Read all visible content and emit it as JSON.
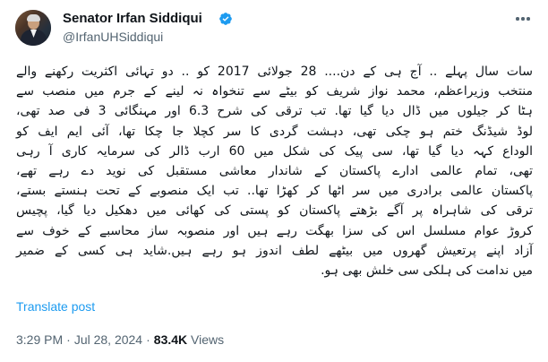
{
  "author": {
    "name": "Senator Irfan Siddiqui",
    "handle": "@IrfanUHSiddiqui",
    "avatar_icon": "avatar-photo",
    "verified_icon": "verified-badge-icon",
    "verified_color": "#1d9bf0"
  },
  "post": {
    "lines": [
      "سات سال پہلے .. آج ہی کے دن.... 28 جولائی 2017 کو .. دو تہائی اکثریت رکھنے والے",
      "منتخب وزیراعظم، محمد نواز شریف کو بیٹے سے تنخواہ نہ لینے کے جرم میں منصب سے",
      "ہٹا کر جیلوں میں ڈال دیا گیا تھا. تب ترقی کی شرح 6.3 اور مہنگائی 3 فی صد تھی،",
      "لوڈ شیڈنگ ختم ہو چکی تھی، دہشت گردی کا سر کچلا جا چکا تھا، آئی ایم ایف کو",
      "الوداع کہہ دیا گیا تھا، سی پیک کی شکل میں 60 ارب ڈالر کی سرمایہ کاری آ رہی",
      "تھی، تمام عالمی ادارے پاکستان کے شاندار معاشی مستقبل کی نوید دے رہے تھے،",
      "پاکستان عالمی برادری میں سر اٹھا کر کھڑا تھا.. تب ایک منصوبے کے تحت ہنستے بستے،",
      "ترقی کی شاہراہ پر آگے بڑھتے پاکستان کو پستی کی کھائی میں دھکیل دیا گیا، پچیس",
      "کروڑ عوام مسلسل اس کی سزا بھگت رہے ہیں اور منصوبہ ساز محاسبے کے خوف سے",
      "آزاد اپنے پرتعیش گھروں میں بیٹھے لطف اندوز ہو رہے ہیں.شاید ہی کسی کے ضمیر",
      "میں ندامت کی ہلکی سی خلش بھی ہو."
    ],
    "translate_label": "Translate post",
    "time": "3:29 PM",
    "separator_1": "·",
    "date": "Jul 28, 2024",
    "separator_2": "·",
    "views_count": "83.4K",
    "views_label": "Views"
  },
  "more_menu_icon": "more-options-icon",
  "link_color": "#1d9bf0",
  "muted_color": "#536471"
}
